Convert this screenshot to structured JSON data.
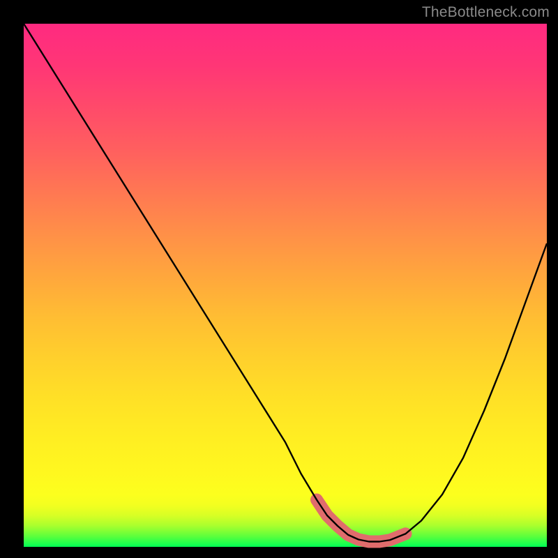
{
  "watermark": "TheBottleneck.com",
  "chart_data": {
    "type": "line",
    "title": "",
    "xlabel": "",
    "ylabel": "",
    "xlim": [
      0,
      100
    ],
    "ylim": [
      0,
      100
    ],
    "series": [
      {
        "name": "curve",
        "x": [
          0,
          5,
          10,
          15,
          20,
          25,
          30,
          35,
          40,
          45,
          50,
          53,
          56,
          58,
          60,
          62,
          64,
          66,
          68,
          70,
          73,
          76,
          80,
          84,
          88,
          92,
          96,
          100
        ],
        "y": [
          100,
          92,
          84,
          76,
          68,
          60,
          52,
          44,
          36,
          28,
          20,
          14,
          9,
          6,
          4,
          2.3,
          1.4,
          1.0,
          1.0,
          1.3,
          2.5,
          5,
          10,
          17,
          26,
          36,
          47,
          58
        ]
      }
    ],
    "highlight": {
      "name": "bottom-segment",
      "x": [
        56,
        58,
        60,
        62,
        64,
        66,
        68,
        70,
        73
      ],
      "y": [
        9,
        6,
        4,
        2.3,
        1.4,
        1.0,
        1.0,
        1.3,
        2.5
      ],
      "color": "#e06c6c",
      "width": 14
    },
    "background_gradient": {
      "bottom": "#00ff55",
      "mid": "#fff020",
      "top": "#ff2a80"
    }
  }
}
